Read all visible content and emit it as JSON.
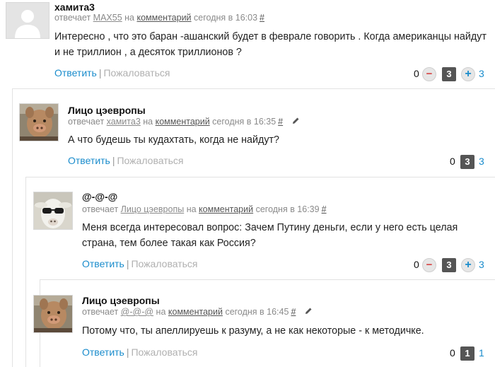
{
  "colors": {
    "link": "#1a8ccc",
    "muted": "#8a8a8a",
    "score_bg": "#555555",
    "minus": "#d64545"
  },
  "comments": [
    {
      "author": "хамита3",
      "replies_label": "отвечает",
      "reply_to": "MAX55",
      "on_label": "на",
      "comment_link": "комментарий",
      "time": "сегодня в 16:03",
      "hash": "#",
      "text": "Интересно , что это баран -ашанский будет в феврале говорить . Когда американцы найдут и не триллион , а десяток триллионов ?",
      "reply": "Ответить",
      "sep": "|",
      "report": "Пожаловаться",
      "votes_down": "0",
      "score": "3",
      "votes_up": "3",
      "avatar_icon": "default-user-avatar"
    },
    {
      "author": "Лицо цэевропы",
      "replies_label": "отвечает",
      "reply_to": "хамита3",
      "on_label": "на",
      "comment_link": "комментарий",
      "time": "сегодня в 16:35",
      "hash": "#",
      "text": "А что будешь ты кудахтать, когда не найдут?",
      "reply": "Ответить",
      "sep": "|",
      "report": "Пожаловаться",
      "votes_down": "0",
      "score": "3",
      "votes_up": "3",
      "avatar_icon": "pig-face-avatar"
    },
    {
      "author": "@-@-@",
      "replies_label": "отвечает",
      "reply_to": "Лицо цэевропы",
      "on_label": "на",
      "comment_link": "комментарий",
      "time": "сегодня в 16:39",
      "hash": "#",
      "text": "Меня всегда интересовал вопрос: Зачем Путину деньги, если у него есть целая страна, тем более такая как Россия?",
      "reply": "Ответить",
      "sep": "|",
      "report": "Пожаловаться",
      "votes_down": "0",
      "score": "3",
      "votes_up": "3",
      "avatar_icon": "goat-sunglasses-avatar"
    },
    {
      "author": "Лицо цэевропы",
      "replies_label": "отвечает",
      "reply_to": "@-@-@",
      "on_label": "на",
      "comment_link": "комментарий",
      "time": "сегодня в 16:45",
      "hash": "#",
      "text": "Потому что, ты апеллируешь к разуму, а не как некоторые - к методичке.",
      "reply": "Ответить",
      "sep": "|",
      "report": "Пожаловаться",
      "votes_down": "0",
      "score": "1",
      "votes_up": "1",
      "avatar_icon": "pig-face-avatar"
    }
  ]
}
